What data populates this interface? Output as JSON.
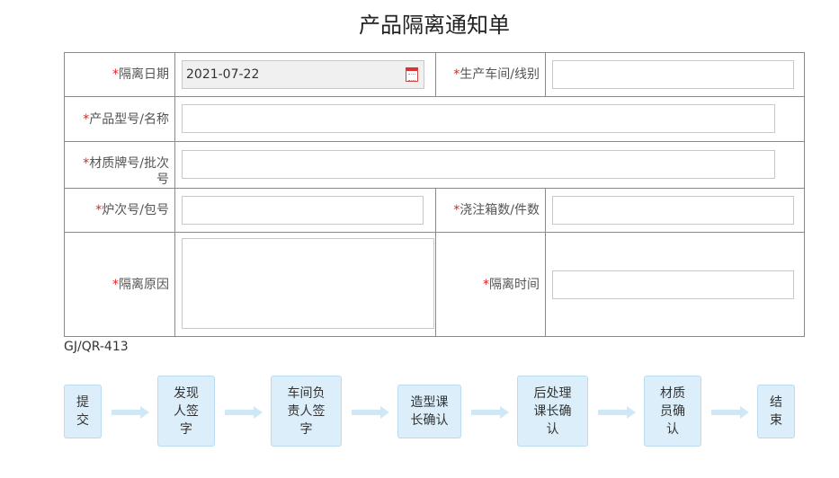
{
  "title": "产品隔离通知单",
  "form": {
    "isolation_date": {
      "label": "隔离日期",
      "value": "2021-07-22"
    },
    "workshop_line": {
      "label": "生产车间/线别",
      "value": ""
    },
    "product_model": {
      "label": "产品型号/名称",
      "value": ""
    },
    "material_batch": {
      "label_1": "材质牌号/批次",
      "label_2": "号",
      "value": ""
    },
    "furnace_no": {
      "label": "炉次号/包号",
      "value": ""
    },
    "pour_boxes": {
      "label": "浇注箱数/件数",
      "value": ""
    },
    "reason": {
      "label": "隔离原因",
      "value": ""
    },
    "isolation_time": {
      "label": "隔离时间",
      "value": ""
    },
    "required_mark": "*"
  },
  "doc_code": "GJ/QR-413",
  "workflow": {
    "steps": [
      {
        "l1": "提",
        "l2": "交",
        "l3": ""
      },
      {
        "l1": "发现",
        "l2": "人签",
        "l3": "字"
      },
      {
        "l1": "车间负",
        "l2": "责人签",
        "l3": "字"
      },
      {
        "l1": "造型课",
        "l2": "长确认",
        "l3": ""
      },
      {
        "l1": "后处理",
        "l2": "课长确",
        "l3": "认"
      },
      {
        "l1": "材质",
        "l2": "员确",
        "l3": "认"
      },
      {
        "l1": "结",
        "l2": "束",
        "l3": ""
      }
    ]
  }
}
